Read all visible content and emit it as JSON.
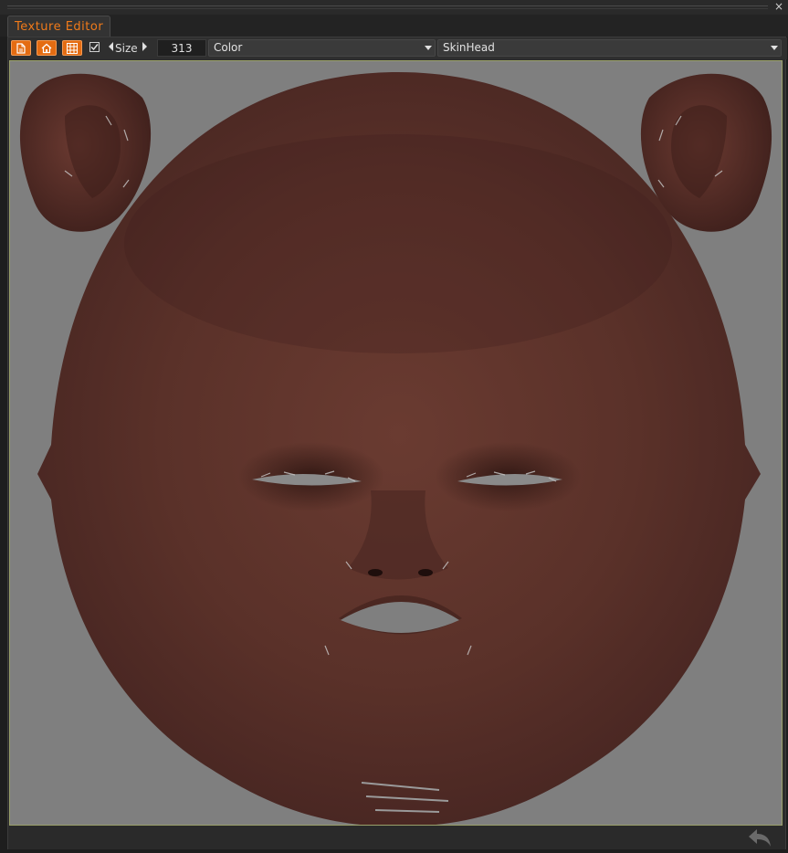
{
  "window": {
    "close_label": "×",
    "tab_title": "Texture Editor"
  },
  "toolbar": {
    "buttons": [
      "new-texture-icon",
      "home-icon",
      "grid-icon"
    ],
    "checkbox_checked": true,
    "size_label": "Size",
    "size_value": "313",
    "channel_select": "Color",
    "material_select": "SkinHead"
  },
  "colors": {
    "accent": "#f07a1a",
    "button_fill": "#e46c12",
    "canvas_bg": "#7f7f7f",
    "skin": "#5a322a"
  },
  "statusbar": {
    "undo_icon": "undo-icon"
  }
}
